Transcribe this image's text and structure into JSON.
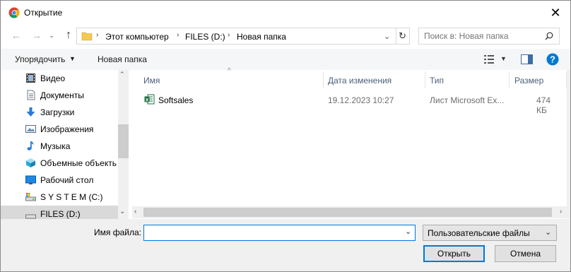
{
  "window": {
    "title": "Открытие",
    "close_label": "✕"
  },
  "address": {
    "crumbs": [
      "Этот компьютер",
      "FILES (D:)",
      "Новая папка"
    ]
  },
  "search": {
    "placeholder": "Поиск в: Новая папка"
  },
  "toolbar": {
    "organize": "Упорядочить",
    "new_folder": "Новая папка"
  },
  "sidebar": {
    "items": [
      {
        "label": "Видео",
        "icon": "video-icon"
      },
      {
        "label": "Документы",
        "icon": "documents-icon"
      },
      {
        "label": "Загрузки",
        "icon": "downloads-icon"
      },
      {
        "label": "Изображения",
        "icon": "pictures-icon"
      },
      {
        "label": "Музыка",
        "icon": "music-icon"
      },
      {
        "label": "Объемные объекть",
        "icon": "3d-objects-icon"
      },
      {
        "label": "Рабочий стол",
        "icon": "desktop-icon"
      },
      {
        "label": "S Y S T E M (C:)",
        "icon": "drive-c-icon"
      },
      {
        "label": "FILES (D:)",
        "icon": "drive-d-icon",
        "selected": true
      }
    ]
  },
  "columns": {
    "name": "Имя",
    "date": "Дата изменения",
    "type": "Тип",
    "size": "Размер"
  },
  "files": [
    {
      "name": "Softsales",
      "date": "19.12.2023 10:27",
      "type": "Лист Microsoft Ex...",
      "size": "474 КБ",
      "icon": "excel-file-icon"
    }
  ],
  "bottom": {
    "filename_label": "Имя файла:",
    "filename_value": "",
    "filter_value": "Пользовательские файлы",
    "open_label": "Открыть",
    "cancel_label": "Отмена"
  },
  "colors": {
    "accent": "#0078d7",
    "header_text": "#4c607a",
    "folder": "#f3c94e",
    "excel": "#1d6f42"
  }
}
